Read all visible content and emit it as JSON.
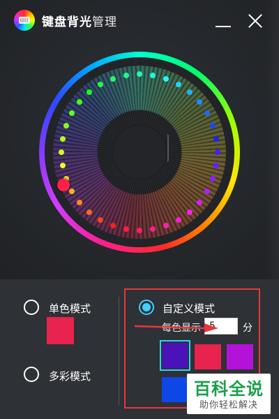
{
  "window": {
    "title_bold": "键盘背光",
    "title_rest": "管理",
    "icon": "keyboard-rainbow-icon",
    "minimize_icon": "minimize-icon",
    "close_icon": "close-icon"
  },
  "wheel": {
    "selected_color": "#ff1f4a"
  },
  "modes": {
    "single": {
      "label": "单色模式",
      "checked": false,
      "color": "#e8234d"
    },
    "multi": {
      "label": "多彩模式",
      "checked": false
    },
    "custom": {
      "label": "自定义模式",
      "checked": true,
      "interval_prefix": "每色显示",
      "interval_value": "5",
      "interval_unit": "分",
      "colors": [
        "#4a12b8",
        "#e8234d",
        "#b313d9",
        "#0d47e6"
      ],
      "selected_index": 0
    }
  },
  "watermark": {
    "main": "百科全说",
    "sub": "助你轻松解决"
  }
}
